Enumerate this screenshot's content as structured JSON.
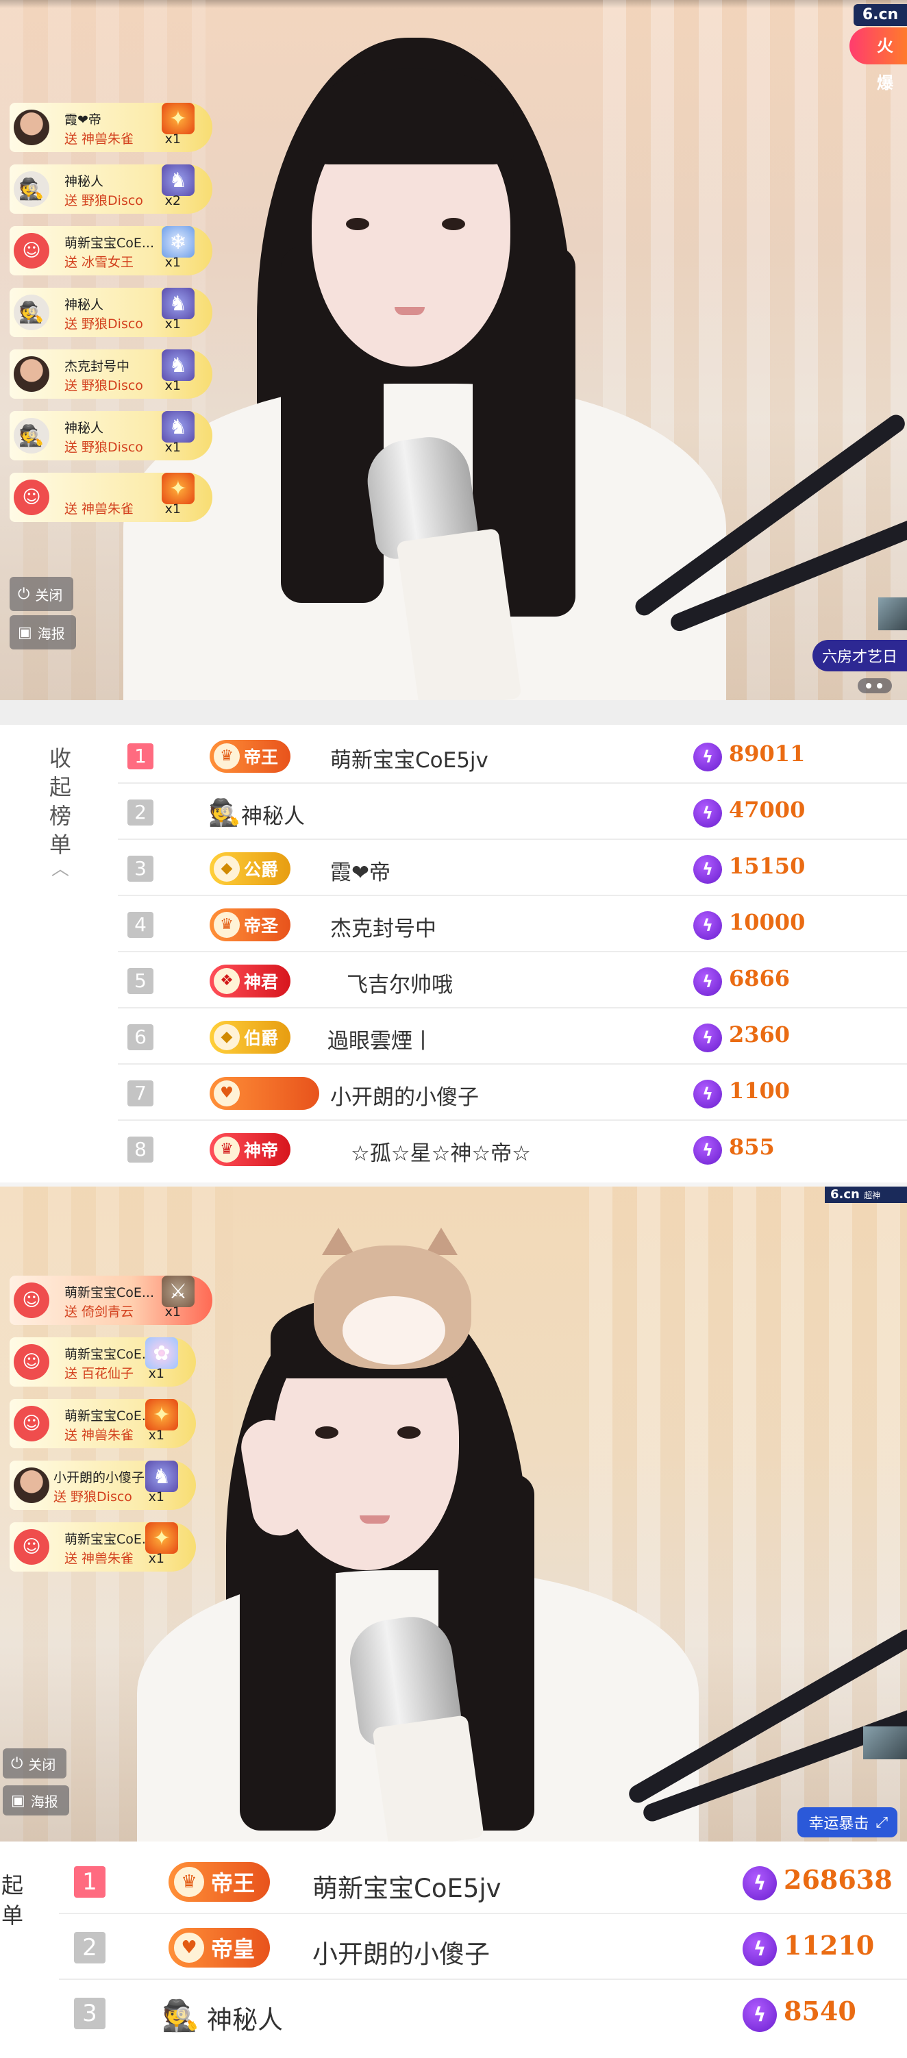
{
  "video1": {
    "logo": "6.cn",
    "hot_badge": "火爆",
    "room_tag": "六房才艺日",
    "controls": {
      "close": "关闭",
      "poster": "海报"
    },
    "gift_feed": [
      {
        "name": "霞❤帝",
        "gift": "送 神兽朱雀",
        "count": "x1",
        "avatar": "photo",
        "icon": "phoenix"
      },
      {
        "name": "神秘人",
        "gift": "送 野狼Disco",
        "count": "x2",
        "avatar": "hat",
        "icon": "disco"
      },
      {
        "name": "萌新宝宝CoE...",
        "gift": "送 冰雪女王",
        "count": "x1",
        "avatar": "red",
        "icon": "ice"
      },
      {
        "name": "神秘人",
        "gift": "送 野狼Disco",
        "count": "x1",
        "avatar": "hat",
        "icon": "disco"
      },
      {
        "name": "杰克封号中",
        "gift": "送 野狼Disco",
        "count": "x1",
        "avatar": "photo",
        "icon": "disco"
      },
      {
        "name": "神秘人",
        "gift": "送 野狼Disco",
        "count": "x1",
        "avatar": "hat",
        "icon": "disco"
      },
      {
        "name": "",
        "gift": "送 神兽朱雀",
        "count": "x1",
        "avatar": "red",
        "icon": "phoenix"
      }
    ]
  },
  "ranking1": {
    "collapse_label": "收起榜单",
    "rows": [
      {
        "rank": "1",
        "badge": "帝王",
        "badge_style": "orange",
        "name": "萌新宝宝CoE5jv",
        "amount": "89011"
      },
      {
        "rank": "2",
        "badge": "",
        "badge_style": "hat",
        "name": "神秘人",
        "amount": "47000"
      },
      {
        "rank": "3",
        "badge": "公爵",
        "badge_style": "gold",
        "name": "霞❤帝",
        "amount": "15150"
      },
      {
        "rank": "4",
        "badge": "帝圣",
        "badge_style": "orange",
        "name": "杰克封号中",
        "amount": "10000"
      },
      {
        "rank": "5",
        "badge": "神君",
        "badge_style": "red",
        "name": "飞吉尔帅哦",
        "amount": "6866"
      },
      {
        "rank": "6",
        "badge": "伯爵",
        "badge_style": "gold",
        "name": "過眼雲煙丨",
        "amount": "2360"
      },
      {
        "rank": "7",
        "badge": "",
        "badge_style": "orange",
        "name": "小开朗的小傻子",
        "amount": "1100"
      },
      {
        "rank": "8",
        "badge": "神帝",
        "badge_style": "red",
        "name": "☆孤☆星☆神☆帝☆",
        "amount": "855"
      }
    ]
  },
  "video2": {
    "logo": "6.cn",
    "logo_extra": "超神",
    "lucky_button": "幸运暴击",
    "controls": {
      "close": "关闭",
      "poster": "海报"
    },
    "gift_feed": [
      {
        "name": "萌新宝宝CoE...",
        "gift": "送 倚剑青云",
        "count": "x1",
        "avatar": "red",
        "icon": "sword"
      },
      {
        "name": "萌新宝宝CoE...",
        "gift": "送 百花仙子",
        "count": "x1",
        "avatar": "red",
        "icon": "fairy"
      },
      {
        "name": "萌新宝宝CoE...",
        "gift": "送 神兽朱雀",
        "count": "x1",
        "avatar": "red",
        "icon": "phoenix"
      },
      {
        "name": "小开朗的小傻子",
        "gift": "送 野狼Disco",
        "count": "x1",
        "avatar": "photo",
        "icon": "disco"
      },
      {
        "name": "萌新宝宝CoE...",
        "gift": "送 神兽朱雀",
        "count": "x1",
        "avatar": "red",
        "icon": "phoenix"
      }
    ]
  },
  "ranking2": {
    "edge_label": "起单",
    "rows": [
      {
        "rank": "1",
        "badge": "帝王",
        "badge_style": "orange",
        "name": "萌新宝宝CoE5jv",
        "amount": "268638"
      },
      {
        "rank": "2",
        "badge": "帝皇",
        "badge_style": "orange",
        "name": "小开朗的小傻子",
        "amount": "11210"
      },
      {
        "rank": "3",
        "badge": "",
        "badge_style": "hat",
        "name": "神秘人",
        "amount": "8540"
      }
    ]
  },
  "colors": {
    "amount": "#ea6b12",
    "rank_first": "#ff6b80",
    "gift_sub": "#d3421f",
    "lucky_button": "#2b59d9"
  },
  "icons": {
    "coin": "lightning-coin-icon",
    "hat": "spy-hat-icon",
    "power": "power-icon",
    "poster": "image-icon"
  }
}
